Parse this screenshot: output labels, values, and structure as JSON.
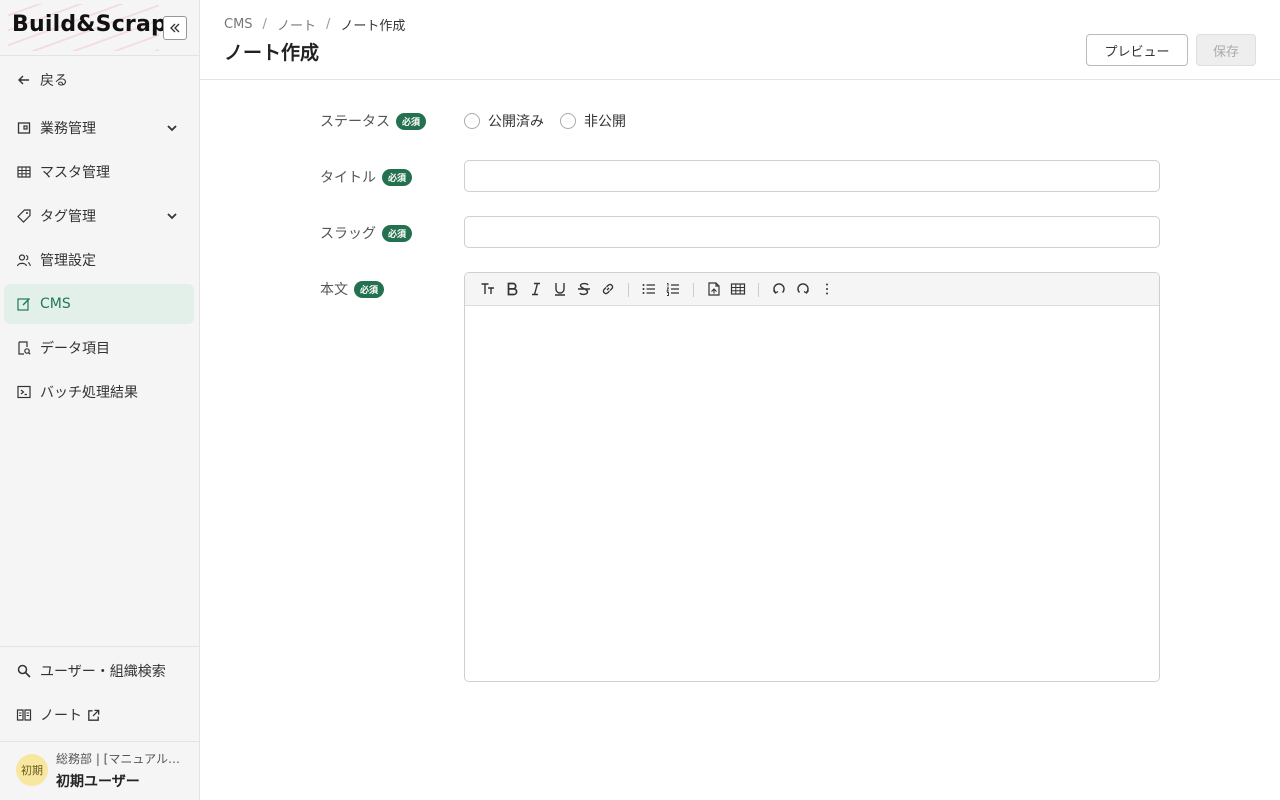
{
  "brand": {
    "name": "Build&Scrap"
  },
  "sidebar": {
    "items": [
      {
        "label": "戻る"
      },
      {
        "label": "業務管理"
      },
      {
        "label": "マスタ管理"
      },
      {
        "label": "タグ管理"
      },
      {
        "label": "管理設定"
      },
      {
        "label": "CMS"
      },
      {
        "label": "データ項目"
      },
      {
        "label": "バッチ処理結果"
      }
    ],
    "bottom_items": [
      {
        "label": "ユーザー・組織検索"
      },
      {
        "label": "ノート"
      }
    ],
    "user": {
      "avatar": "初期",
      "org": "総務部 | [マニュアル…",
      "name": "初期ユーザー"
    }
  },
  "header": {
    "breadcrumb": [
      "CMS",
      "ノート",
      "ノート作成"
    ],
    "breadcrumb_sep": "/",
    "title": "ノート作成",
    "preview_label": "プレビュー",
    "save_label": "保存"
  },
  "form": {
    "required_badge": "必須",
    "status": {
      "label": "ステータス",
      "options": [
        "公開済み",
        "非公開"
      ]
    },
    "title_field": {
      "label": "タイトル",
      "value": ""
    },
    "slug_field": {
      "label": "スラッグ",
      "value": ""
    },
    "body_field": {
      "label": "本文",
      "value": ""
    }
  },
  "colors": {
    "accent": "#24714f",
    "active_bg": "#e3f0ea",
    "active_text": "#1f7a55"
  }
}
